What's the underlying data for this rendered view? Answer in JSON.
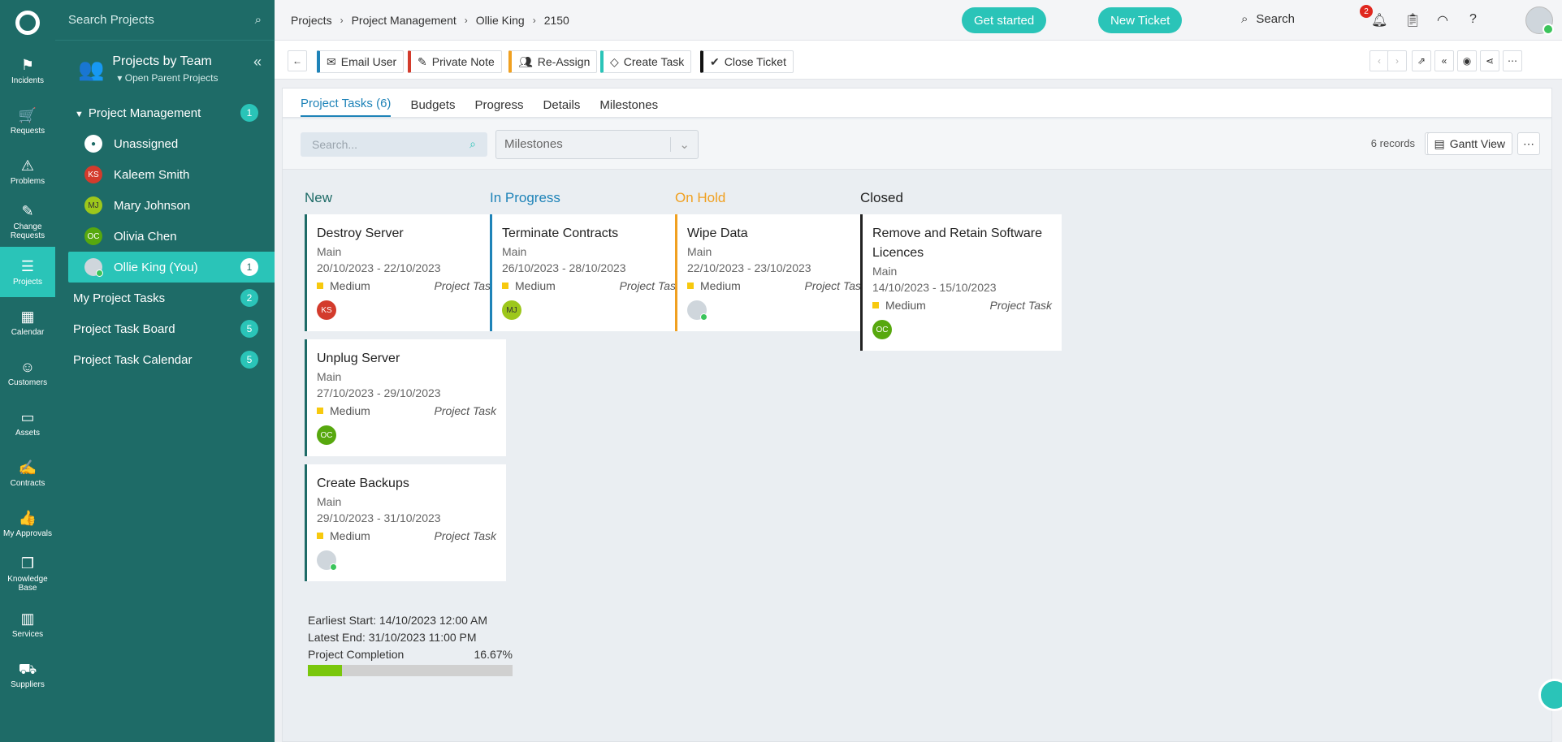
{
  "rail": {
    "items": [
      {
        "icon": "incidents-icon",
        "label": "Incidents",
        "glyph": "⚑"
      },
      {
        "icon": "requests-icon",
        "label": "Requests",
        "glyph": "🛒"
      },
      {
        "icon": "problems-icon",
        "label": "Problems",
        "glyph": "⚠"
      },
      {
        "icon": "change-requests-icon",
        "label": "Change Requests",
        "glyph": "✎"
      },
      {
        "icon": "projects-icon",
        "label": "Projects",
        "glyph": "☰"
      },
      {
        "icon": "calendar-icon",
        "label": "Calendar",
        "glyph": "▦"
      },
      {
        "icon": "customers-icon",
        "label": "Customers",
        "glyph": "☺"
      },
      {
        "icon": "assets-icon",
        "label": "Assets",
        "glyph": "▭"
      },
      {
        "icon": "contracts-icon",
        "label": "Contracts",
        "glyph": "✍"
      },
      {
        "icon": "my-approvals-icon",
        "label": "My Approvals",
        "glyph": "👍"
      },
      {
        "icon": "knowledge-base-icon",
        "label": "Knowledge Base",
        "glyph": "❒"
      },
      {
        "icon": "services-icon",
        "label": "Services",
        "glyph": "▥"
      },
      {
        "icon": "suppliers-icon",
        "label": "Suppliers",
        "glyph": "⛟"
      }
    ]
  },
  "sidebar": {
    "search_placeholder": "Search Projects",
    "title": "Projects by Team",
    "subtitle": "Open Parent Projects",
    "group": {
      "label": "Project Management",
      "count": "1"
    },
    "users": [
      {
        "initials": "",
        "name": "Unassigned"
      },
      {
        "initials": "KS",
        "name": "Kaleem Smith"
      },
      {
        "initials": "MJ",
        "name": "Mary Johnson"
      },
      {
        "initials": "OC",
        "name": "Olivia Chen"
      },
      {
        "initials": "",
        "name": "Ollie King (You)",
        "count": "1"
      }
    ],
    "links": [
      {
        "label": "My Project Tasks",
        "count": "2"
      },
      {
        "label": "Project Task Board",
        "count": "5"
      },
      {
        "label": "Project Task Calendar",
        "count": "5"
      }
    ]
  },
  "topbar": {
    "breadcrumbs": [
      "Projects",
      "Project Management",
      "Ollie King",
      "2150"
    ],
    "get_started": "Get started",
    "new_ticket": "New Ticket",
    "search_label": "Search",
    "notification_count": "2"
  },
  "actions": {
    "email_user": "Email User",
    "private_note": "Private Note",
    "reassign": "Re-Assign",
    "create_task": "Create Task",
    "close_ticket": "Close Ticket"
  },
  "tabs": [
    "Project Tasks (6)",
    "Budgets",
    "Progress",
    "Details",
    "Milestones"
  ],
  "filters": {
    "search_placeholder": "Search...",
    "milestones_placeholder": "Milestones",
    "records": "6 records",
    "gantt_view": "Gantt View"
  },
  "columns": [
    {
      "title": "New",
      "color": "#1e6b67",
      "cards": [
        {
          "title": "Destroy Server",
          "milestone": "Main",
          "dates": "20/10/2023 - 22/10/2023",
          "priority": "Medium",
          "type": "Project Task",
          "assignee": "KS"
        },
        {
          "title": "Unplug Server",
          "milestone": "Main",
          "dates": "27/10/2023 - 29/10/2023",
          "priority": "Medium",
          "type": "Project Task",
          "assignee": "OC"
        },
        {
          "title": "Create Backups",
          "milestone": "Main",
          "dates": "29/10/2023 - 31/10/2023",
          "priority": "Medium",
          "type": "Project Task",
          "assignee": "photo"
        }
      ]
    },
    {
      "title": "In Progress",
      "color": "#1e83b8",
      "cards": [
        {
          "title": "Terminate Contracts",
          "milestone": "Main",
          "dates": "26/10/2023 - 28/10/2023",
          "priority": "Medium",
          "type": "Project Task",
          "assignee": "MJ"
        }
      ]
    },
    {
      "title": "On Hold",
      "color": "#f0a020",
      "cards": [
        {
          "title": "Wipe Data",
          "milestone": "Main",
          "dates": "22/10/2023 - 23/10/2023",
          "priority": "Medium",
          "type": "Project Task",
          "assignee": "photo"
        }
      ]
    },
    {
      "title": "Closed",
      "color": "#222222",
      "cards": [
        {
          "title": "Remove and Retain Software Licences",
          "milestone": "Main",
          "dates": "14/10/2023 - 15/10/2023",
          "priority": "Medium",
          "type": "Project Task",
          "assignee": "OC"
        }
      ]
    }
  ],
  "summary": {
    "earliest_start": "Earliest Start: 14/10/2023 12:00 AM",
    "latest_end": "Latest End: 31/10/2023 11:00 PM",
    "completion_label": "Project Completion",
    "completion_value": "16.67%",
    "completion_fraction": 0.1667
  }
}
